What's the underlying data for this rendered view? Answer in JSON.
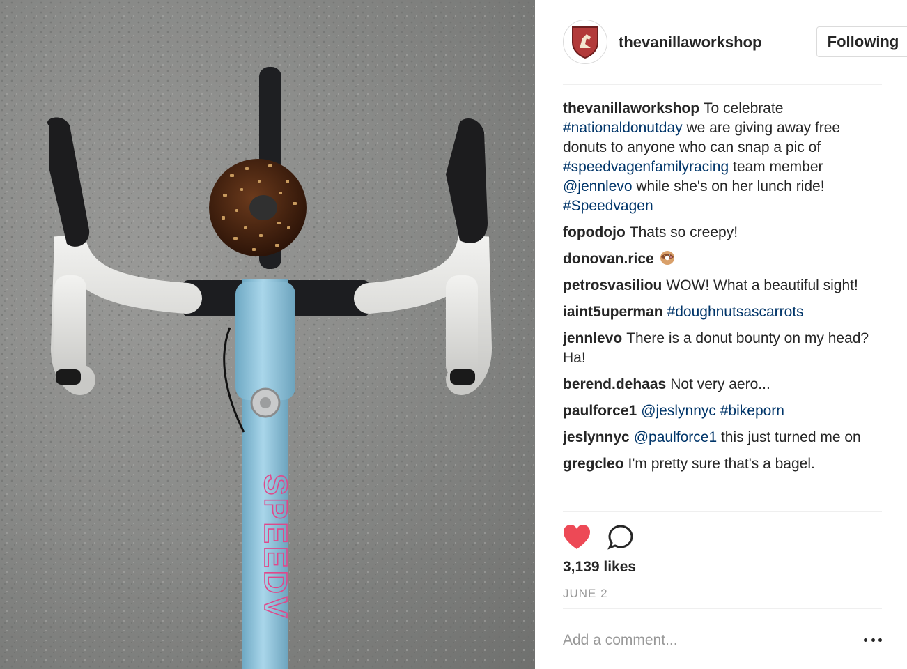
{
  "post": {
    "author": "thevanillaworkshop",
    "follow_label": "Following",
    "likes": "3,139 likes",
    "date": "JUNE 2",
    "add_comment_placeholder": "Add a comment...",
    "liked": true,
    "accent_color": "#ed4956",
    "link_color": "#003569"
  },
  "photo": {
    "frame_lettering": "SPEEDV"
  },
  "comments": [
    {
      "user": "thevanillaworkshop",
      "parts": [
        {
          "t": "To celebrate "
        },
        {
          "t": "#nationaldonutday",
          "link": true
        },
        {
          "t": " we are giving away free donuts to anyone who can snap a pic of "
        },
        {
          "t": "#speedvagenfamilyracing",
          "link": true
        },
        {
          "t": " team member "
        },
        {
          "t": "@jennlevo",
          "link": true
        },
        {
          "t": " while she's on her lunch ride! "
        },
        {
          "t": "#Speedvagen",
          "link": true
        }
      ]
    },
    {
      "user": "fopodojo",
      "parts": [
        {
          "t": "Thats so creepy!"
        }
      ]
    },
    {
      "user": "donovan.rice",
      "parts": [],
      "emoji": "donut-icon"
    },
    {
      "user": "petrosvasiliou",
      "parts": [
        {
          "t": "WOW! What a beautiful sight!"
        }
      ]
    },
    {
      "user": "iaint5uperman",
      "parts": [
        {
          "t": "#doughnutsascarrots",
          "link": true
        }
      ]
    },
    {
      "user": "jennlevo",
      "parts": [
        {
          "t": "There is a donut bounty on my head? Ha!"
        }
      ]
    },
    {
      "user": "berend.dehaas",
      "parts": [
        {
          "t": "Not very aero..."
        }
      ]
    },
    {
      "user": "paulforce1",
      "parts": [
        {
          "t": "@jeslynnyc",
          "link": true
        },
        {
          "t": " "
        },
        {
          "t": "#bikeporn",
          "link": true
        }
      ]
    },
    {
      "user": "jeslynnyc",
      "parts": [
        {
          "t": "@paulforce1",
          "link": true
        },
        {
          "t": " this just turned me on"
        }
      ]
    },
    {
      "user": "gregcleo",
      "parts": [
        {
          "t": "I'm pretty sure that's a bagel."
        }
      ]
    }
  ]
}
